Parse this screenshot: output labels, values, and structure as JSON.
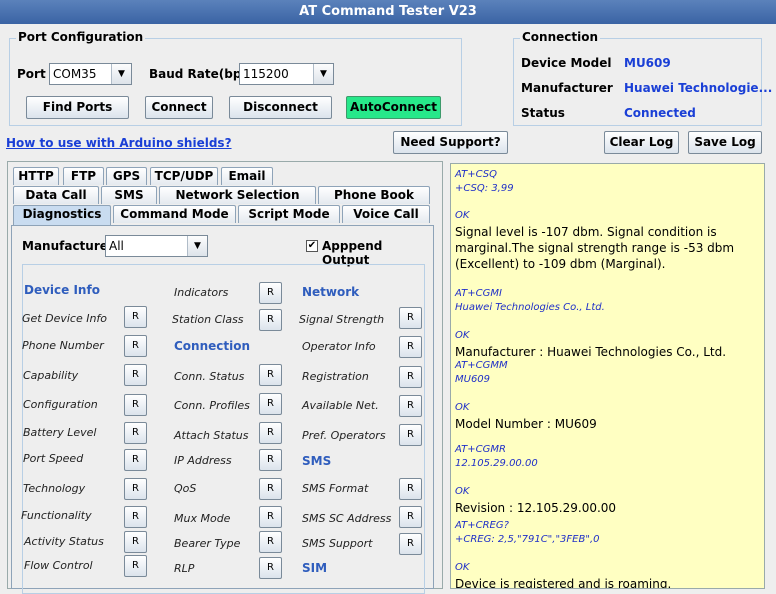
{
  "window": {
    "title": "AT Command Tester V23"
  },
  "port_config": {
    "title": "Port Configuration",
    "port_label": "Port",
    "port_value": "COM35",
    "baud_label": "Baud Rate(bps)",
    "baud_value": "115200",
    "find_ports": "Find Ports",
    "connect": "Connect",
    "disconnect": "Disconnect",
    "autoconnect": "AutoConnect"
  },
  "connection": {
    "title": "Connection",
    "device_model_label": "Device Model",
    "device_model_value": "MU609",
    "manufacturer_label": "Manufacturer",
    "manufacturer_value": "Huawei Technologie...",
    "status_label": "Status",
    "status_value": "Connected"
  },
  "links": {
    "arduino": "How to use with Arduino shields?"
  },
  "actions": {
    "need_support": "Need Support?",
    "clear_log": "Clear Log",
    "save_log": "Save Log"
  },
  "tabs": {
    "row1": [
      "HTTP",
      "FTP",
      "GPS",
      "TCP/UDP",
      "Email"
    ],
    "row2": [
      "Data Call",
      "SMS",
      "Network Selection",
      "Phone Book"
    ],
    "row3": [
      "Diagnostics",
      "Command Mode",
      "Script Mode",
      "Voice Call"
    ]
  },
  "diagnostics": {
    "manufacturer_label": "Manufacturer",
    "manufacturer_value": "All",
    "append_label": "Apppend Output",
    "append_checked": "✔",
    "col1": {
      "section": "Device Info",
      "items": [
        "Get Device Info",
        "Phone Number",
        "Capability",
        "Configuration",
        "Battery Level",
        "Port Speed",
        "Technology",
        "Functionality",
        "Activity Status",
        "Flow Control"
      ]
    },
    "col2": {
      "items_top": [
        "Indicators",
        "Station Class"
      ],
      "section": "Connection",
      "items": [
        "Conn. Status",
        "Conn. Profiles",
        "Attach Status",
        "IP Address",
        "QoS",
        "Mux Mode",
        "Bearer Type",
        "RLP"
      ]
    },
    "col3": {
      "section": "Network",
      "items": [
        "Signal Strength",
        "Operator Info",
        "Registration",
        "Available Net.",
        "Pref. Operators"
      ],
      "sms_section": "SMS",
      "sms_items": [
        "SMS Format",
        "SMS SC Address",
        "SMS Support"
      ],
      "sim_section": "SIM"
    },
    "r_label": "R"
  },
  "log": [
    {
      "t": "cmd",
      "text": "AT+CSQ"
    },
    {
      "t": "cmd",
      "text": "+CSQ: 3,99"
    },
    {
      "t": "cmd",
      "text": "OK"
    },
    {
      "t": "resp",
      "text": "Signal level is -107 dbm. Signal condition is marginal.The signal strength range is -53 dbm (Excellent) to -109 dbm (Marginal)."
    },
    {
      "t": "cmd",
      "text": "AT+CGMI"
    },
    {
      "t": "cmd",
      "text": "Huawei Technologies Co., Ltd."
    },
    {
      "t": "cmd",
      "text": "OK"
    },
    {
      "t": "resp",
      "text": "Manufacturer : Huawei Technologies Co., Ltd."
    },
    {
      "t": "cmd",
      "text": "AT+CGMM"
    },
    {
      "t": "cmd",
      "text": "MU609"
    },
    {
      "t": "cmd",
      "text": "OK"
    },
    {
      "t": "resp",
      "text": "Model Number : MU609"
    },
    {
      "t": "cmd",
      "text": "AT+CGMR"
    },
    {
      "t": "cmd",
      "text": "12.105.29.00.00"
    },
    {
      "t": "cmd",
      "text": "OK"
    },
    {
      "t": "resp",
      "text": "Revision : 12.105.29.00.00"
    },
    {
      "t": "cmd",
      "text": "AT+CREG?"
    },
    {
      "t": "cmd",
      "text": "+CREG: 2,5,\"791C\",\"3FEB\",0"
    },
    {
      "t": "cmd",
      "text": "OK"
    },
    {
      "t": "resp",
      "text": "Device is registered and is roaming."
    }
  ]
}
